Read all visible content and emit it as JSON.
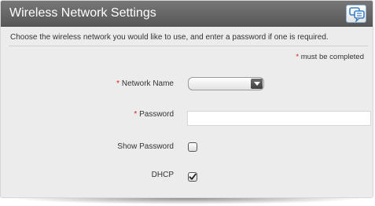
{
  "window": {
    "title": "Wireless Network Settings",
    "help_icon": "help-chat-icon"
  },
  "intro": "Choose the wireless network you would like to use, and enter a password if one is required.",
  "required_note": {
    "star": "*",
    "text": "must be completed"
  },
  "form": {
    "network_name": {
      "star": "*",
      "label": "Network Name",
      "selected_value": ""
    },
    "password": {
      "star": "*",
      "label": "Password",
      "value": ""
    },
    "show_password": {
      "label": "Show Password",
      "checked": false
    },
    "dhcp": {
      "label": "DHCP",
      "checked": true
    }
  },
  "colors": {
    "titlebar": "#666666",
    "required_star": "#d02020",
    "panel_background": "#ececec"
  }
}
